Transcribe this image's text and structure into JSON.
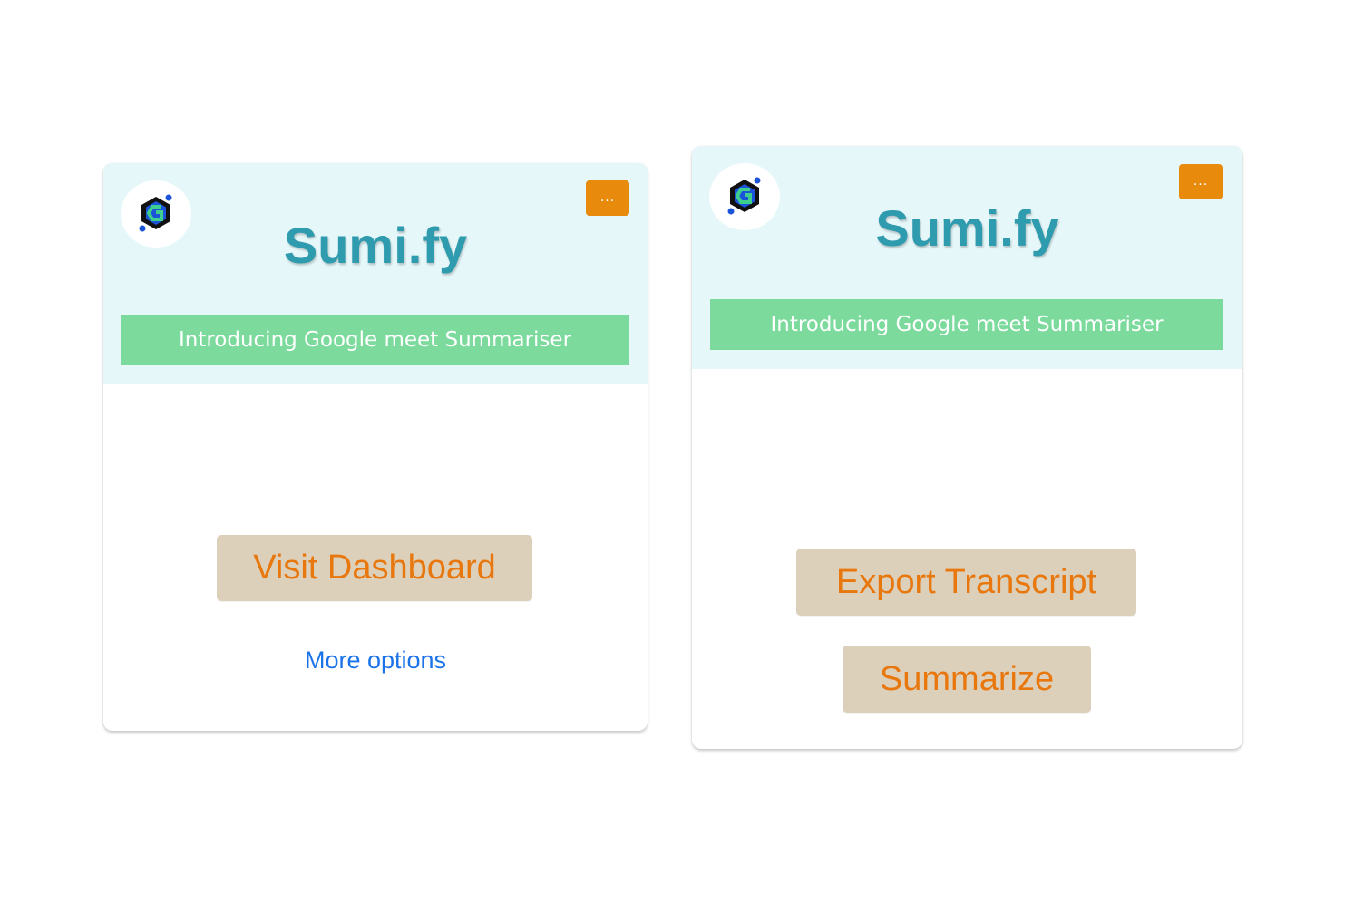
{
  "colors": {
    "header_bg": "#e5f7f9",
    "brand_text": "#2f9bae",
    "banner_bg": "#7bda9c",
    "menu_button_bg": "#e88a0c",
    "action_button_bg": "#ddd0bb",
    "action_button_text": "#e8770d",
    "link_text": "#1a73e8"
  },
  "cards": [
    {
      "logo_icon": "sumify-hexagon-logo-icon",
      "menu_label": "...",
      "brand": "Sumi.fy",
      "banner": "Introducing Google meet Summariser",
      "primary_button": "Visit Dashboard",
      "more_options": "More options"
    },
    {
      "logo_icon": "sumify-hexagon-logo-icon",
      "menu_label": "...",
      "brand": "Sumi.fy",
      "banner": "Introducing Google meet Summariser",
      "export_button": "Export Transcript",
      "summarize_button": "Summarize"
    }
  ]
}
